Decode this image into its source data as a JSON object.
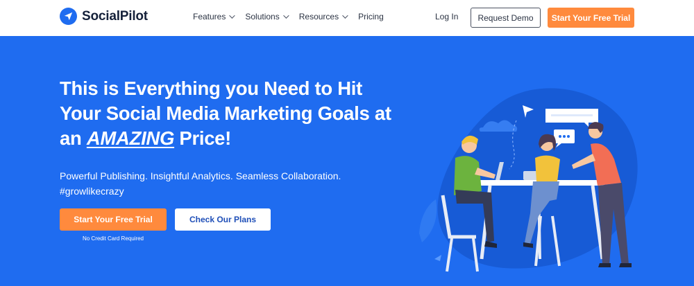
{
  "nav": {
    "brand": "SocialPilot",
    "logo_icon": "paper-plane-icon",
    "menu": [
      {
        "label": "Features",
        "has_dropdown": true
      },
      {
        "label": "Solutions",
        "has_dropdown": true
      },
      {
        "label": "Resources",
        "has_dropdown": true
      },
      {
        "label": "Pricing",
        "has_dropdown": false
      }
    ],
    "login": "Log In",
    "request_demo": "Request Demo",
    "cta": "Start Your Free Trial"
  },
  "hero": {
    "headline_part1": "This is Everything you Need to Hit Your Social Media Marketing Goals at an ",
    "headline_emphasis": "AMAZING",
    "headline_part2": " Price!",
    "subline1": "Powerful Publishing. Insightful Analytics. Seamless Collaboration.",
    "subline2": "#growlikecrazy",
    "primary_cta": "Start Your Free Trial",
    "secondary_cta": "Check Our Plans",
    "note": "No Credit Card Required"
  },
  "colors": {
    "brand_blue": "#1f6cf0",
    "accent_orange": "#ff8a3d",
    "nav_text": "#2a3242"
  }
}
